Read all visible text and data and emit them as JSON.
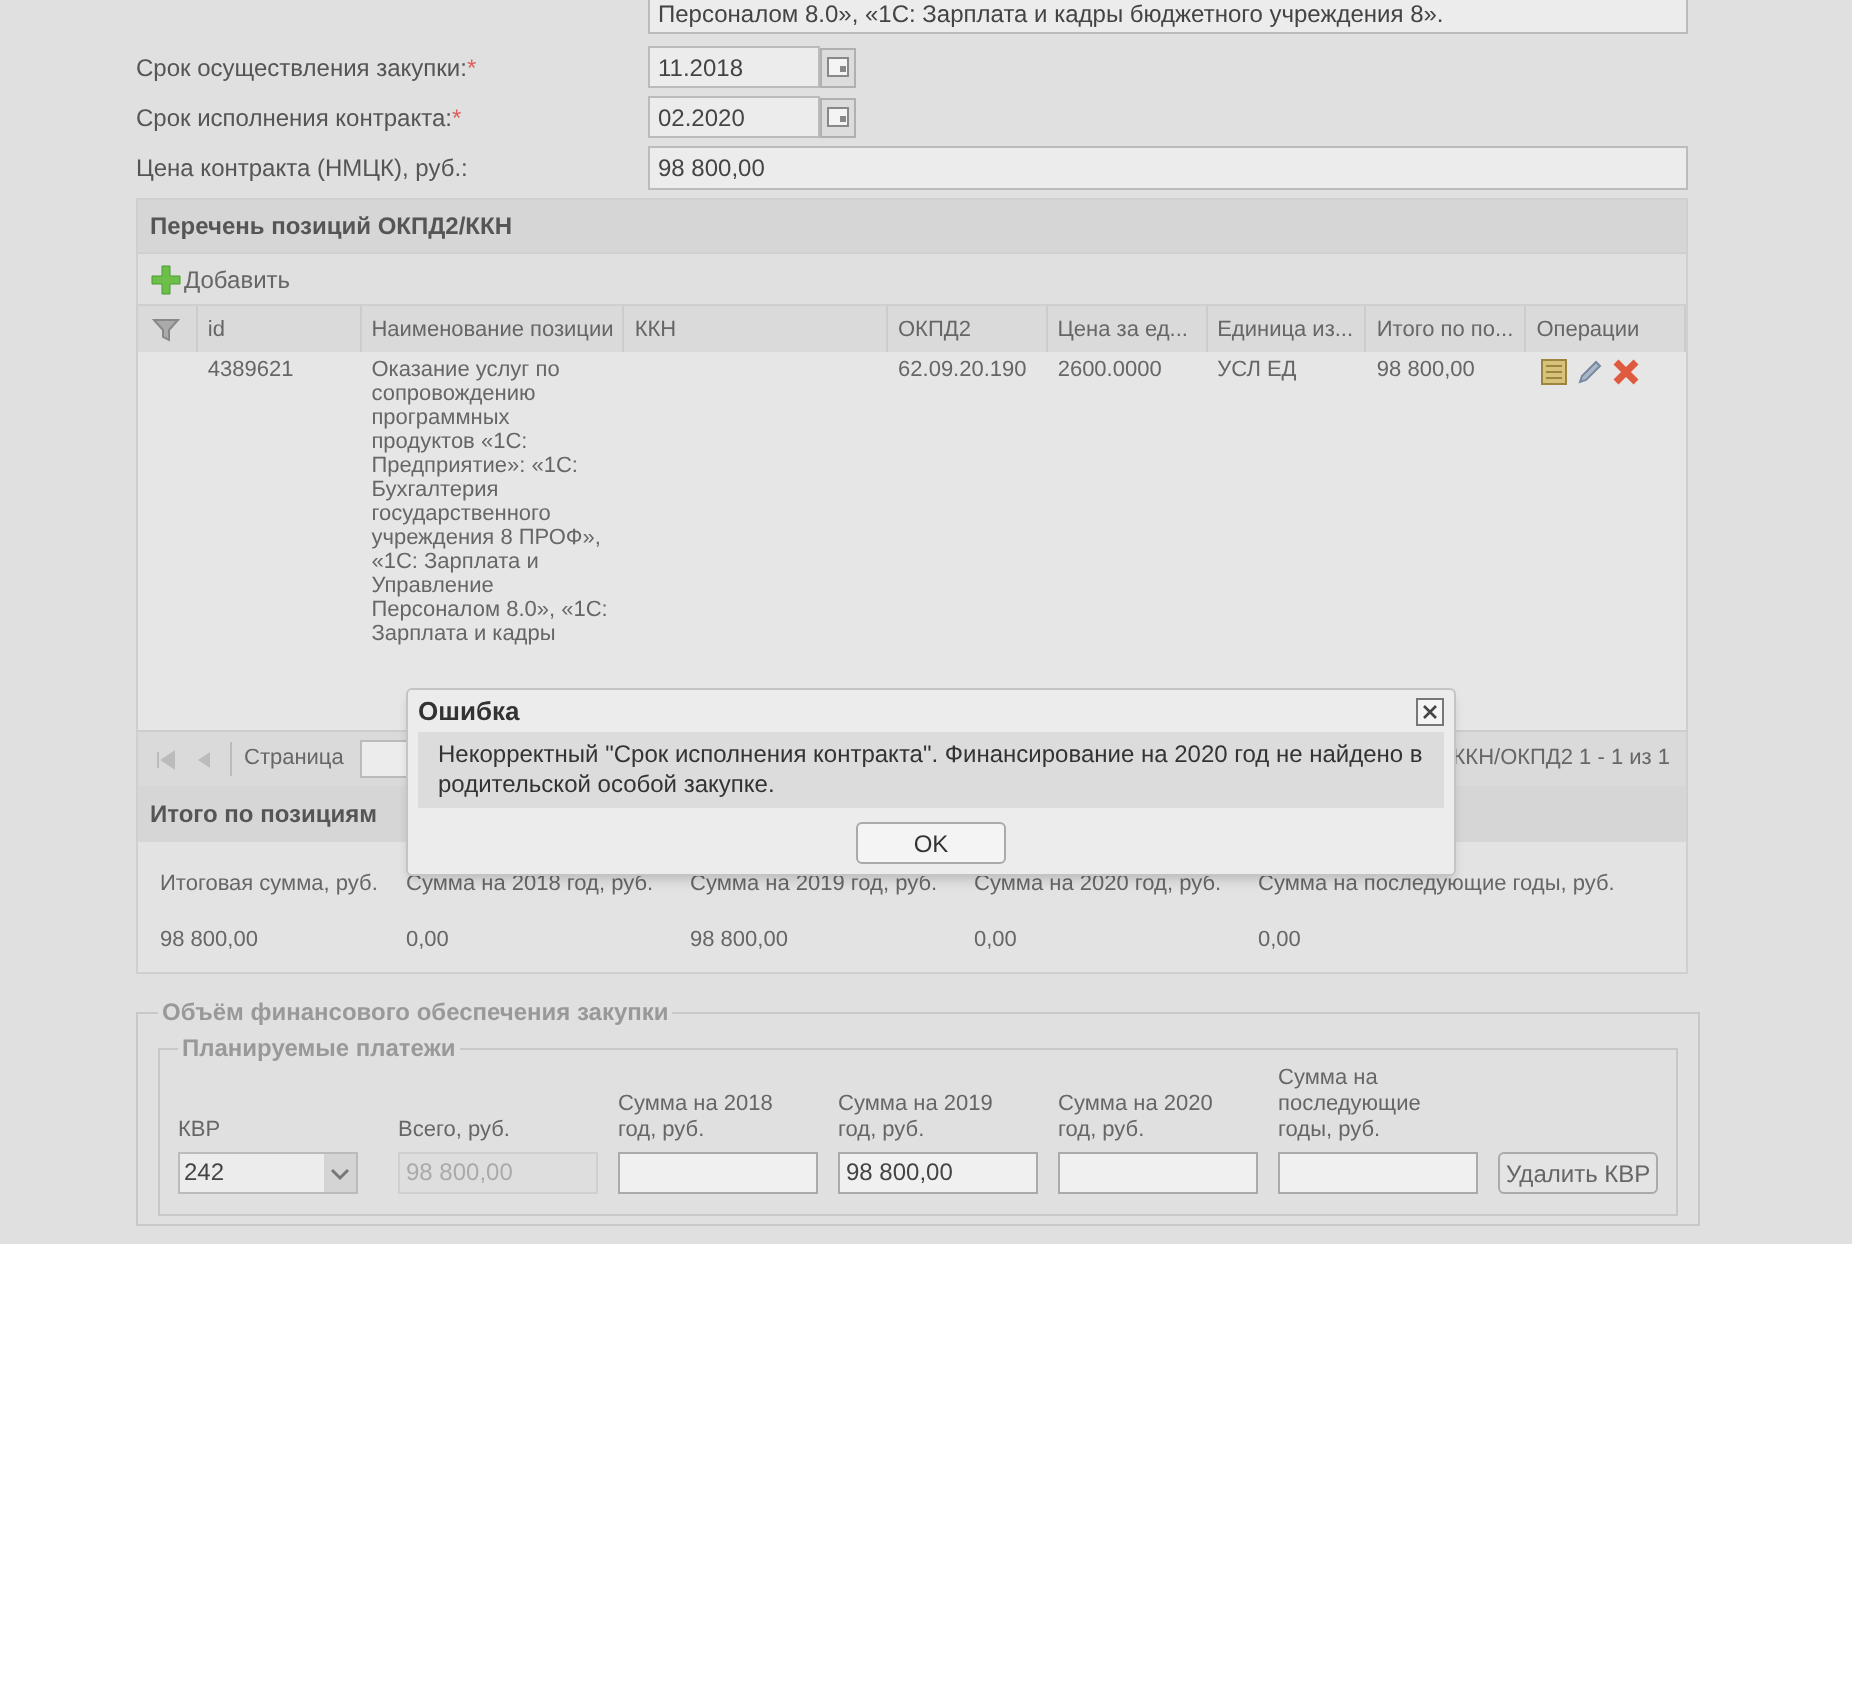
{
  "description_tail": "Персоналом 8.0», «1С: Зарплата и кадры бюджетного учреждения 8».",
  "fields": [
    {
      "label": "Срок осуществления закупки:",
      "required_mark": "*",
      "value": "11.2018",
      "kind": "date"
    },
    {
      "label": "Срок исполнения контракта:",
      "required_mark": "*",
      "value": "02.2020",
      "kind": "date"
    },
    {
      "label": "Цена контракта (НМЦК), руб.:",
      "value": "98 800,00",
      "kind": "text"
    }
  ],
  "positions": {
    "title": "Перечень позиций ОКПД2/ККН",
    "add_button": "Добавить",
    "columns": [
      "id",
      "Наименование позиции",
      "ККН",
      "ОКПД2",
      "Цена за ед...",
      "Единица из...",
      "Итого по по...",
      "Операции"
    ],
    "rows": [
      {
        "id": "4389621",
        "name": "Оказание услуг по сопровождению программных продуктов «1С: Предприятие»: «1С: Бухгалтерия государственного учреждения 8 ПРОФ», «1С: Зарплата и Управление Персоналом 8.0», «1С: Зарплата и кадры",
        "okpd2": "62.09.20.190",
        "price": "2600.0000",
        "unit": "УСЛ ЕД",
        "total": "98 800,00"
      }
    ],
    "pager": {
      "page_label": "Страница",
      "summary": "ККН/ОКПД2 1 - 1 из 1"
    }
  },
  "totals": {
    "title": "Итого по позициям",
    "columns": [
      {
        "label": "Итоговая сумма, руб.",
        "value": "98 800,00"
      },
      {
        "label": "Сумма на 2018 год, руб.",
        "value": "0,00"
      },
      {
        "label": "Сумма на 2019 год, руб.",
        "value": "98 800,00"
      },
      {
        "label": "Сумма на 2020 год, руб.",
        "value": "0,00"
      },
      {
        "label": "Сумма на последующие годы, руб.",
        "value": "0,00"
      }
    ]
  },
  "funding": {
    "title": "Объём финансового обеспечения закупки",
    "planned_title": "Планируемые платежи",
    "columns": [
      {
        "label": "КВР",
        "value": "242",
        "kind": "select"
      },
      {
        "label": "Всего, руб.",
        "value": "98 800,00",
        "kind": "input",
        "disabled": true
      },
      {
        "label": "Сумма на 2018 год, руб.",
        "kind": "input",
        "disabled": false
      },
      {
        "label": "Сумма на 2019 год, руб.",
        "value": "98 800,00",
        "kind": "input",
        "disabled": false
      },
      {
        "label": "Сумма на 2020 год, руб.",
        "kind": "input",
        "disabled": false
      },
      {
        "label": "Сумма на последующие годы, руб.",
        "kind": "input",
        "disabled": false
      }
    ],
    "delete_button": "Удалить КВР"
  },
  "dialog": {
    "title": "Ошибка",
    "message": "Некорректный \"Срок исполнения контракта\". Финансирование на 2020 год не найдено в родительской особой закупке.",
    "ok_button": "OK"
  }
}
